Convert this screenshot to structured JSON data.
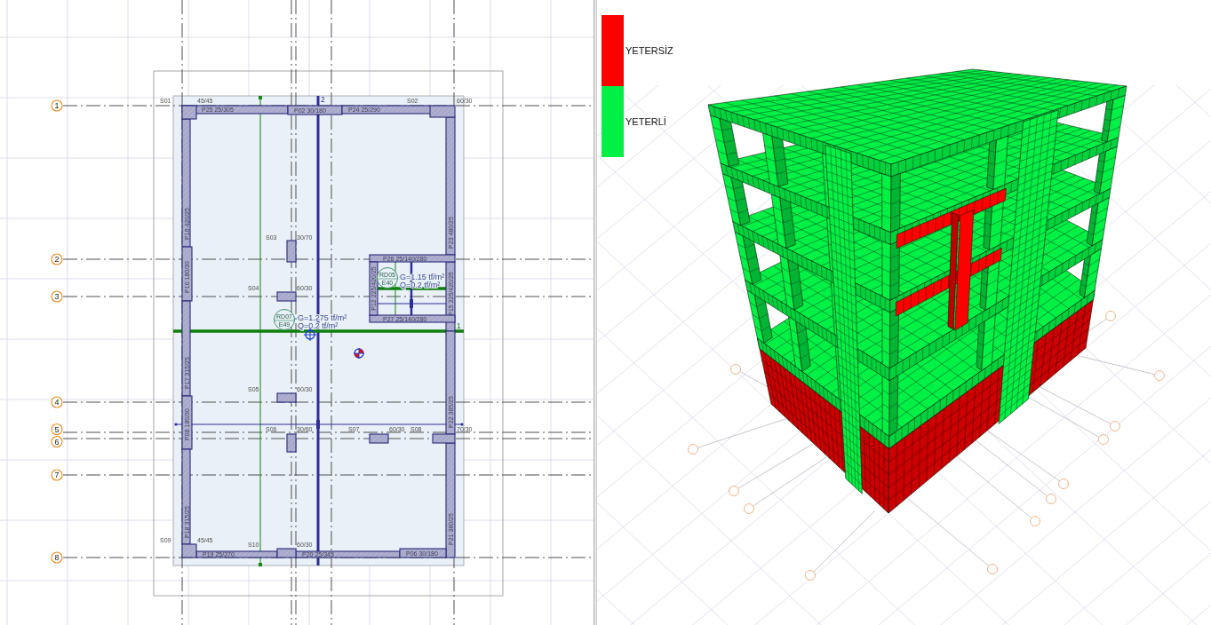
{
  "plan_view": {
    "axes": [
      {
        "label": "1"
      },
      {
        "label": "2"
      },
      {
        "label": "3"
      },
      {
        "label": "4"
      },
      {
        "label": "5"
      },
      {
        "label": "6"
      },
      {
        "label": "7"
      },
      {
        "label": "8"
      }
    ],
    "walls": [
      {
        "label": "P25 25/305"
      },
      {
        "label": "P02 30/180"
      },
      {
        "label": "P24 25/290"
      },
      {
        "label": "P16 420/25"
      },
      {
        "label": "P10 180/30"
      },
      {
        "label": "P17 315/25"
      },
      {
        "label": "P08 180/30"
      },
      {
        "label": "P18 315/25"
      },
      {
        "label": "P23 480/25"
      },
      {
        "label": "P15 225/420/25"
      },
      {
        "label": "P22 385/25"
      },
      {
        "label": "P21 380/25"
      },
      {
        "label": "P26 25/140/280"
      },
      {
        "label": "P27 25/140/280"
      },
      {
        "label": "P12 225/420/25"
      },
      {
        "label": "P19 25/270"
      },
      {
        "label": "P20 25/345"
      },
      {
        "label": "P06 30/180"
      }
    ],
    "columns": [
      {
        "name": "S01",
        "size": "45/45"
      },
      {
        "name": "S02",
        "size": "60/30"
      },
      {
        "name": "S03",
        "size": "30/70"
      },
      {
        "name": "S04",
        "size": "60/30"
      },
      {
        "name": "S05",
        "size": "60/30"
      },
      {
        "name": "S06",
        "size": "30/60"
      },
      {
        "name": "S07",
        "size": "60/30"
      },
      {
        "name": "S08",
        "size": "70/30"
      },
      {
        "name": "S09",
        "size": "45/45"
      },
      {
        "name": "S10",
        "size": "60/30"
      }
    ],
    "slabs": [
      {
        "code": "RD05",
        "thickness": "E40",
        "dead_load": "G=1.15 tf/m²",
        "live_load": "Q=0.2 tf/m²"
      },
      {
        "code": "RD07",
        "thickness": "E49",
        "dead_load": "G=1.275 tf/m²",
        "live_load": "Q=0.2 tf/m²"
      }
    ],
    "beam_labels": [
      "2",
      "1"
    ]
  },
  "model_view": {
    "legend": [
      {
        "label": "YETERSİZ",
        "color": "#ff0000"
      },
      {
        "label": "YETERLİ",
        "color": "#00f046"
      }
    ]
  }
}
